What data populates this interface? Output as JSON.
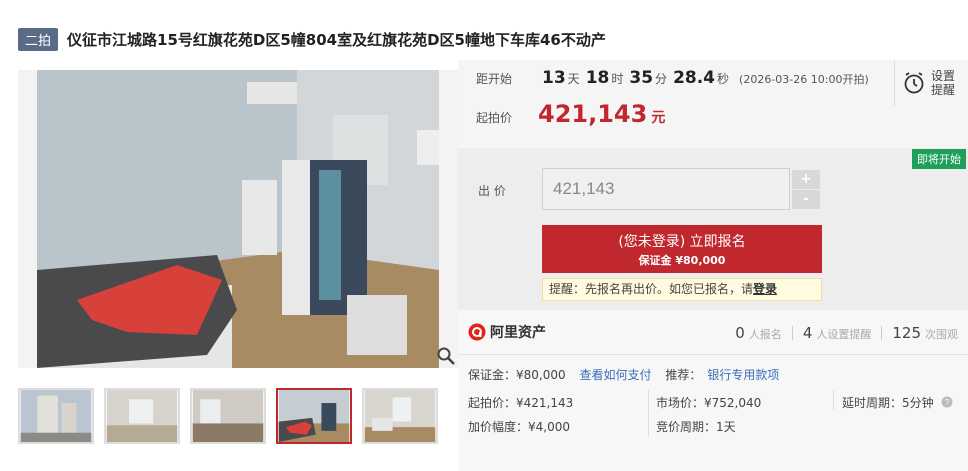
{
  "header": {
    "round_badge": "二拍",
    "title": "仪征市江城路15号红旗花苑D区5幢804室及红旗花苑D区5幢地下车库46不动产"
  },
  "gallery": {
    "thumbnail_count": 5,
    "active_thumbnail_index": 4
  },
  "countdown": {
    "label": "距开始",
    "days": "13",
    "days_unit": "天",
    "hours": "18",
    "hours_unit": "时",
    "minutes": "35",
    "minutes_unit": "分",
    "seconds": "28.4",
    "seconds_unit": "秒",
    "start_time": "(2026-03-26 10:00开拍)"
  },
  "reminder": {
    "label_line1": "设置",
    "label_line2": "提醒"
  },
  "start_price": {
    "label": "起拍价",
    "value": "421,143",
    "unit": "元"
  },
  "bid": {
    "status_badge": "即将开始",
    "label": "出 价",
    "input_value": "421,143",
    "plus": "+",
    "minus": "-",
    "signup_main": "(您未登录) 立即报名",
    "signup_deposit": "保证金 ¥80,000",
    "tip_text": "提醒：先报名再出价。如您已报名，请",
    "tip_login": "登录"
  },
  "platform": {
    "brand": "阿里资产",
    "signups_num": "0",
    "signups_label": "人报名",
    "reminders_num": "4",
    "reminders_label": "人设置提醒",
    "views_num": "125",
    "views_label": "次围观"
  },
  "details": {
    "deposit_label": "保证金：",
    "deposit_value": "¥80,000",
    "how_to_pay": "查看如何支付",
    "recommend_label": "推荐：",
    "recommend_value": "银行专用款项",
    "start_price_label": "起拍价：",
    "start_price_value": "¥421,143",
    "market_price_label": "市场价：",
    "market_price_value": "¥752,040",
    "delay_label": "延时周期：",
    "delay_value": "5分钟",
    "increment_label": "加价幅度：",
    "increment_value": "¥4,000",
    "bid_cycle_label": "竞价周期：",
    "bid_cycle_value": "1天"
  },
  "colors": {
    "accent_red": "#c0282e",
    "badge_green": "#1fa05a",
    "link_blue": "#3a6fb6",
    "round_badge": "#5a6b88"
  }
}
